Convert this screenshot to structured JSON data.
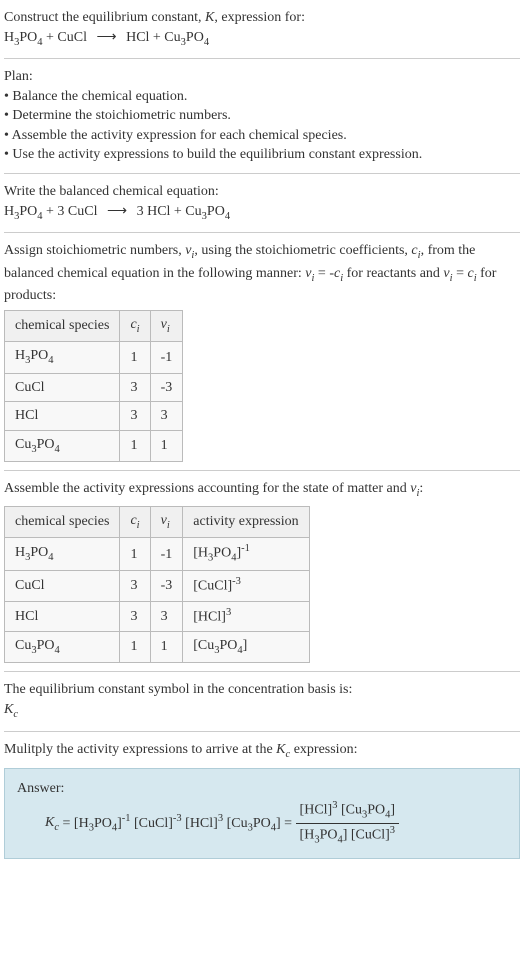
{
  "prompt": {
    "line1": "Construct the equilibrium constant, K, expression for:",
    "reaction_unbalanced": "H₃PO₄ + CuCl ⟶ HCl + Cu₃PO₄"
  },
  "plan": {
    "header": "Plan:",
    "bullets": [
      "Balance the chemical equation.",
      "Determine the stoichiometric numbers.",
      "Assemble the activity expression for each chemical species.",
      "Use the activity expressions to build the equilibrium constant expression."
    ]
  },
  "balanced": {
    "header": "Write the balanced chemical equation:",
    "reaction": "H₃PO₄ + 3 CuCl ⟶ 3 HCl + Cu₃PO₄"
  },
  "stoich": {
    "intro1": "Assign stoichiometric numbers, νᵢ, using the stoichiometric coefficients, cᵢ, from the balanced chemical equation in the following manner: νᵢ = -cᵢ for reactants and νᵢ = cᵢ for products:",
    "headers": {
      "col1": "chemical species",
      "col2": "cᵢ",
      "col3": "νᵢ"
    },
    "rows": [
      {
        "species": "H₃PO₄",
        "c": "1",
        "nu": "-1"
      },
      {
        "species": "CuCl",
        "c": "3",
        "nu": "-3"
      },
      {
        "species": "HCl",
        "c": "3",
        "nu": "3"
      },
      {
        "species": "Cu₃PO₄",
        "c": "1",
        "nu": "1"
      }
    ]
  },
  "activity": {
    "intro": "Assemble the activity expressions accounting for the state of matter and νᵢ:",
    "headers": {
      "col1": "chemical species",
      "col2": "cᵢ",
      "col3": "νᵢ",
      "col4": "activity expression"
    },
    "rows": [
      {
        "species": "H₃PO₄",
        "c": "1",
        "nu": "-1",
        "expr": "[H₃PO₄]⁻¹"
      },
      {
        "species": "CuCl",
        "c": "3",
        "nu": "-3",
        "expr": "[CuCl]⁻³"
      },
      {
        "species": "HCl",
        "c": "3",
        "nu": "3",
        "expr": "[HCl]³"
      },
      {
        "species": "Cu₃PO₄",
        "c": "1",
        "nu": "1",
        "expr": "[Cu₃PO₄]"
      }
    ]
  },
  "ksymbol": {
    "line1": "The equilibrium constant symbol in the concentration basis is:",
    "symbol": "K_c"
  },
  "multiply": {
    "line": "Mulitply the activity expressions to arrive at the K_c expression:"
  },
  "answer": {
    "label": "Answer:",
    "lhs": "K_c = [H₃PO₄]⁻¹ [CuCl]⁻³ [HCl]³ [Cu₃PO₄] =",
    "frac_num": "[HCl]³ [Cu₃PO₄]",
    "frac_den": "[H₃PO₄] [CuCl]³"
  },
  "chart_data": {
    "type": "table",
    "tables": [
      {
        "title": "Stoichiometric numbers",
        "columns": [
          "chemical species",
          "c_i",
          "ν_i"
        ],
        "rows": [
          [
            "H3PO4",
            1,
            -1
          ],
          [
            "CuCl",
            3,
            -3
          ],
          [
            "HCl",
            3,
            3
          ],
          [
            "Cu3PO4",
            1,
            1
          ]
        ]
      },
      {
        "title": "Activity expressions",
        "columns": [
          "chemical species",
          "c_i",
          "ν_i",
          "activity expression"
        ],
        "rows": [
          [
            "H3PO4",
            1,
            -1,
            "[H3PO4]^-1"
          ],
          [
            "CuCl",
            3,
            -3,
            "[CuCl]^-3"
          ],
          [
            "HCl",
            3,
            3,
            "[HCl]^3"
          ],
          [
            "Cu3PO4",
            1,
            1,
            "[Cu3PO4]"
          ]
        ]
      }
    ]
  }
}
